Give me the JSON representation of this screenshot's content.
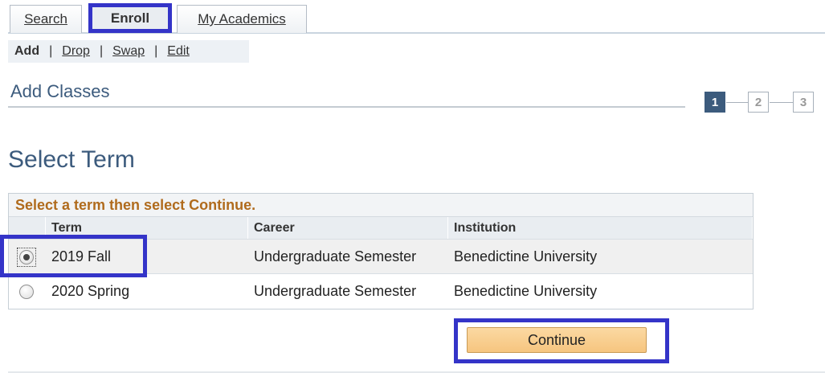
{
  "tabs": {
    "search": "Search",
    "enroll": "Enroll",
    "my_academics": "My Academics"
  },
  "subnav": {
    "add": "Add",
    "drop": "Drop",
    "swap": "Swap",
    "edit": "Edit",
    "separator": "|"
  },
  "page_title": "Add Classes",
  "steps": [
    "1",
    "2",
    "3"
  ],
  "current_step": 1,
  "section_heading": "Select Term",
  "term_table": {
    "instruction": "Select a term then select Continue.",
    "headers": {
      "term": "Term",
      "career": "Career",
      "institution": "Institution"
    },
    "rows": [
      {
        "term": "2019 Fall",
        "career": "Undergraduate Semester",
        "institution": "Benedictine University",
        "selected": true
      },
      {
        "term": "2020 Spring",
        "career": "Undergraduate Semester",
        "institution": "Benedictine University",
        "selected": false
      }
    ]
  },
  "continue_label": "Continue",
  "colors": {
    "accent": "#3c5b7d",
    "instruction": "#b06b1d",
    "highlight": "#3434c8",
    "button": "#f6c57f"
  }
}
